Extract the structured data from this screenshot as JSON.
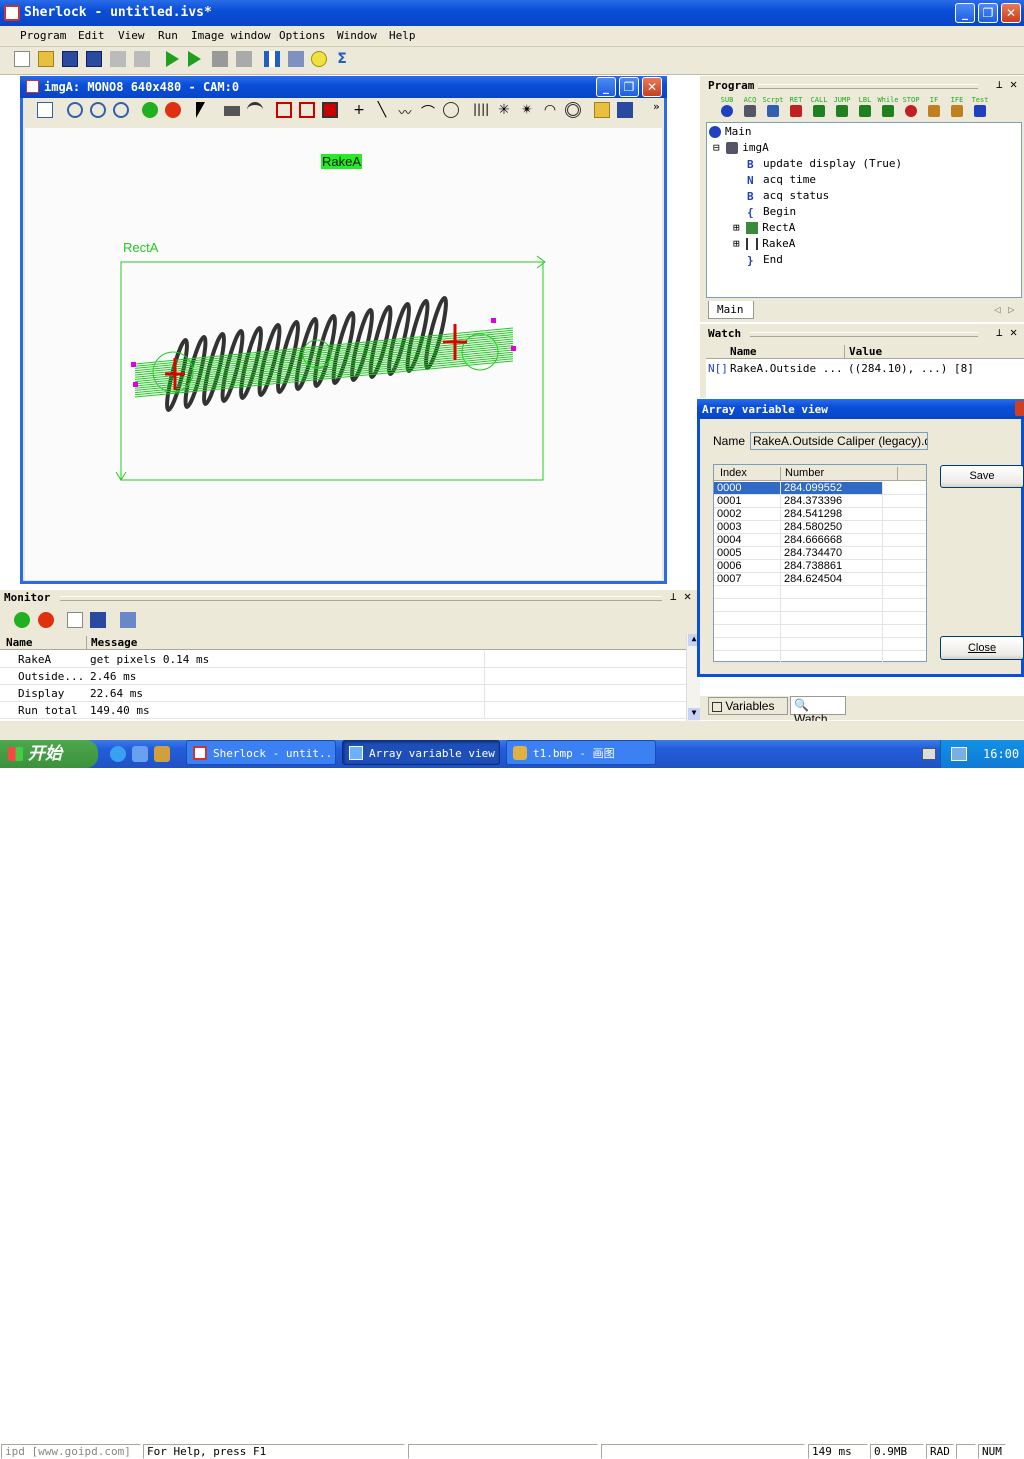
{
  "app_title": "Sherlock - untitled.ivs*",
  "menu": [
    {
      "label": "Program"
    },
    {
      "label": "Edit"
    },
    {
      "label": "View"
    },
    {
      "label": "Run"
    },
    {
      "label": "Image window"
    },
    {
      "label": "Options"
    },
    {
      "label": "Window"
    },
    {
      "label": "Help"
    }
  ],
  "image_window": {
    "title": "imgA: MONO8 640x480 - CAM:0",
    "rake_label": "RakeA",
    "rect_label": "RectA"
  },
  "program": {
    "header": "Program",
    "toolbar": [
      "SUB",
      "ACQ",
      "Scrpt",
      "RET",
      "CALL",
      "JUMP",
      "LBL",
      "While",
      "STOP",
      "IF",
      "IFE",
      "Test"
    ],
    "tree": {
      "main": "Main",
      "imgA": "imgA",
      "update_display": "update display (True)",
      "acq_time": "acq time",
      "acq_status": "acq status",
      "begin": "Begin",
      "rectA": "RectA",
      "rakeA": "RakeA",
      "end": "End"
    },
    "tab": "Main"
  },
  "watch": {
    "header": "Watch",
    "col_name": "Name",
    "col_value": "Value",
    "row": {
      "type": "N[]",
      "name": "RakeA.Outside ...",
      "value": "((284.10), ...) [8]"
    }
  },
  "array_view": {
    "title": "Array variable view",
    "name_label": "Name",
    "name_value": "RakeA.Outside Caliper (legacy).dist",
    "col_index": "Index",
    "col_number": "Number",
    "rows": [
      {
        "index": "0000",
        "number": "284.099552"
      },
      {
        "index": "0001",
        "number": "284.373396"
      },
      {
        "index": "0002",
        "number": "284.541298"
      },
      {
        "index": "0003",
        "number": "284.580250"
      },
      {
        "index": "0004",
        "number": "284.666668"
      },
      {
        "index": "0005",
        "number": "284.734470"
      },
      {
        "index": "0006",
        "number": "284.738861"
      },
      {
        "index": "0007",
        "number": "284.624504"
      }
    ],
    "save": "Save",
    "close": "Close"
  },
  "monitor": {
    "header": "Monitor",
    "col_name": "Name",
    "col_message": "Message",
    "rows": [
      {
        "name": "RakeA",
        "message": "get pixels 0.14 ms"
      },
      {
        "name": "Outside...",
        "message": "2.46 ms"
      },
      {
        "name": "Display",
        "message": "22.64 ms"
      },
      {
        "name": "Run total",
        "message": "149.40 ms"
      }
    ]
  },
  "bottom_tabs": {
    "variables": "Variables",
    "watch": "Watch"
  },
  "status": {
    "watermark": "ipd [www.goipd.com]",
    "help": "For Help, press F1",
    "time": "149 ms",
    "mem": "0.9MB",
    "rad": "RAD",
    "num": "NUM"
  },
  "taskbar": {
    "start": "开始",
    "tasks": [
      "Sherlock - untit...",
      "Array variable view",
      "t1.bmp - 画图"
    ],
    "clock": "16:00"
  },
  "colors": {
    "xp_blue": "#0a4fd8",
    "green": "#22dd22",
    "magenta": "#e000e0"
  }
}
